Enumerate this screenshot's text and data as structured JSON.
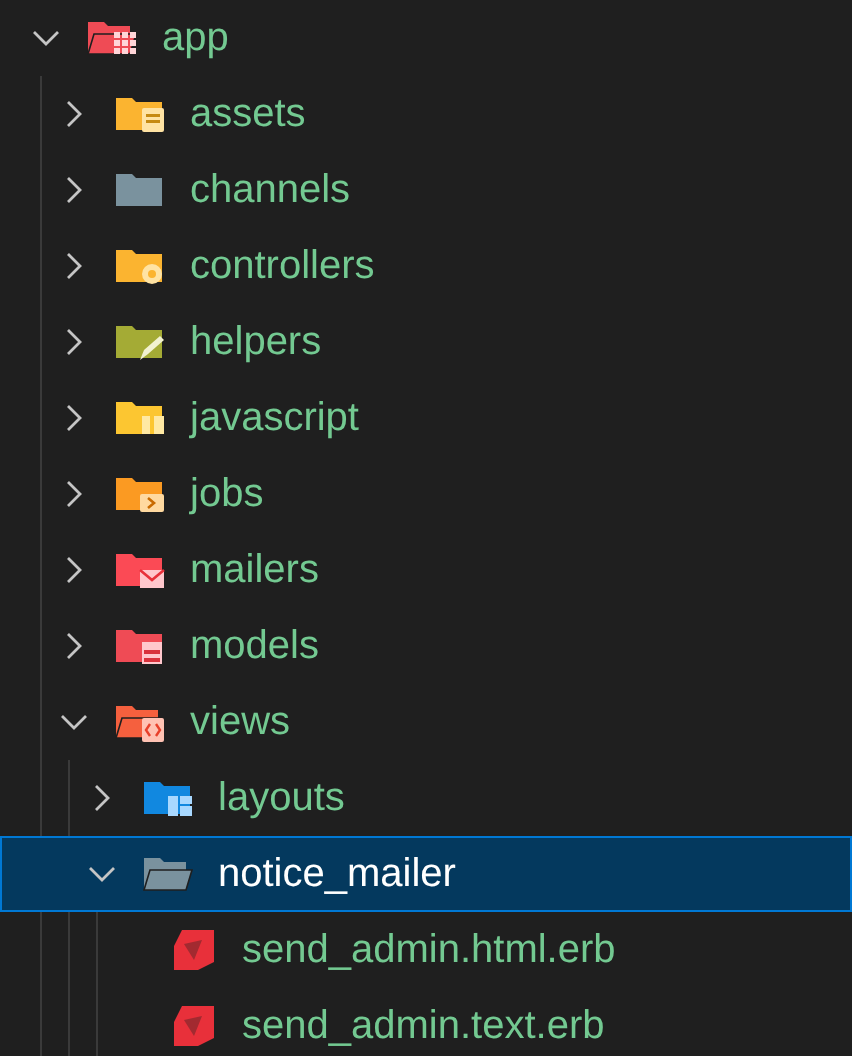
{
  "tree": [
    {
      "name": "app",
      "kind": "grid",
      "color": "#ef4b55",
      "expanded": true,
      "selected": false,
      "children": [
        {
          "name": "assets",
          "kind": "doc",
          "color": "#fbb430",
          "expanded": false,
          "selected": false
        },
        {
          "name": "channels",
          "kind": "plain",
          "color": "#7a929e",
          "expanded": false,
          "selected": false
        },
        {
          "name": "controllers",
          "kind": "gear",
          "color": "#fbb430",
          "expanded": false,
          "selected": false
        },
        {
          "name": "helpers",
          "kind": "pen",
          "color": "#a4ab35",
          "expanded": false,
          "selected": false
        },
        {
          "name": "javascript",
          "kind": "script",
          "color": "#fcc631",
          "expanded": false,
          "selected": false
        },
        {
          "name": "jobs",
          "kind": "job",
          "color": "#fb9a22",
          "expanded": false,
          "selected": false
        },
        {
          "name": "mailers",
          "kind": "mail",
          "color": "#fb4a55",
          "expanded": false,
          "selected": false
        },
        {
          "name": "models",
          "kind": "data",
          "color": "#ef4b55",
          "expanded": false,
          "selected": false
        },
        {
          "name": "views",
          "kind": "code",
          "color": "#f5603e",
          "expanded": true,
          "selected": false,
          "children": [
            {
              "name": "layouts",
              "kind": "layout",
              "color": "#1188e0",
              "expanded": false,
              "selected": false
            },
            {
              "name": "notice_mailer",
              "kind": "plain",
              "color": "#7a929e",
              "expanded": true,
              "selected": true,
              "children": [
                {
                  "name": "send_admin.html.erb",
                  "kind": "ruby",
                  "color": "#e8303a",
                  "selected": false
                },
                {
                  "name": "send_admin.text.erb",
                  "kind": "ruby",
                  "color": "#e8303a",
                  "selected": false
                }
              ]
            }
          ]
        }
      ]
    }
  ]
}
